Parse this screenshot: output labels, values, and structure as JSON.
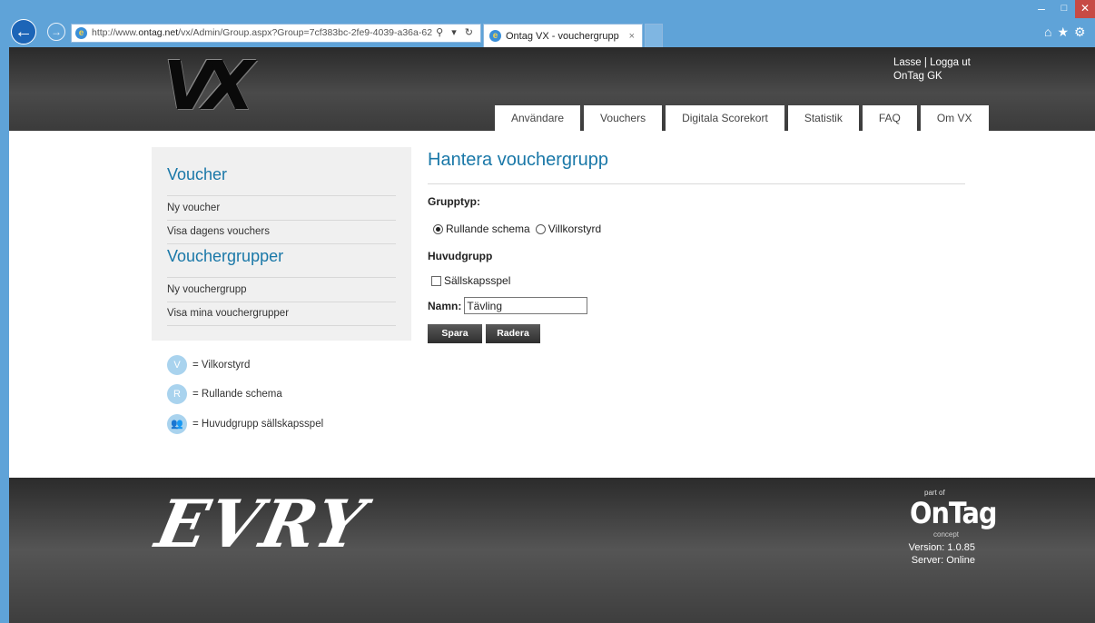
{
  "browser": {
    "url_prefix": "http://www.",
    "url_domain": "ontag.net",
    "url_rest": "/vx/Admin/Group.aspx?Group=7cf383bc-2fe9-4039-a36a-62",
    "tab_title": "Ontag VX - vouchergrupp",
    "tab_close": "×",
    "address_icons": "⚲ ▾ ↻"
  },
  "header": {
    "logo": "VX",
    "user_name": "Lasse",
    "separator": "|",
    "logout": "Logga ut",
    "club": "OnTag GK",
    "menu": [
      {
        "label": "Användare"
      },
      {
        "label": "Vouchers"
      },
      {
        "label": "Digitala Scorekort"
      },
      {
        "label": "Statistik"
      },
      {
        "label": "FAQ"
      },
      {
        "label": "Om VX"
      }
    ]
  },
  "sidebar": {
    "voucher_heading": "Voucher",
    "voucher_links": [
      "Ny voucher",
      "Visa dagens vouchers"
    ],
    "group_heading": "Vouchergrupper",
    "group_links": [
      "Ny vouchergrupp",
      "Visa mina vouchergrupper"
    ]
  },
  "legend": [
    {
      "badge": "V",
      "text": "= Vilkorstyrd"
    },
    {
      "badge": "R",
      "text": "= Rullande schema"
    },
    {
      "badge": "👥",
      "text": "= Huvudgrupp sällskapsspel"
    }
  ],
  "main": {
    "title": "Hantera vouchergrupp",
    "grupptyp_label": "Grupptyp:",
    "radio_rullande": "Rullande schema",
    "radio_villkor": "Villkorstyrd",
    "selected_radio": "Rullande schema",
    "huvudgrupp_label": "Huvudgrupp",
    "checkbox_label": "Sällskapsspel",
    "checkbox_checked": false,
    "name_label": "Namn:",
    "name_value": "Tävling",
    "save_button": "Spara",
    "delete_button": "Radera"
  },
  "footer": {
    "evry": "EVRY",
    "part_of": "part of",
    "brand": "OnTag",
    "concept": "concept",
    "version": "Version: 1.0.85",
    "server": "Server: Online"
  },
  "colors": {
    "accent": "#1a78a8",
    "chrome": "#5fa3d8",
    "badge": "#a9d3ee"
  }
}
